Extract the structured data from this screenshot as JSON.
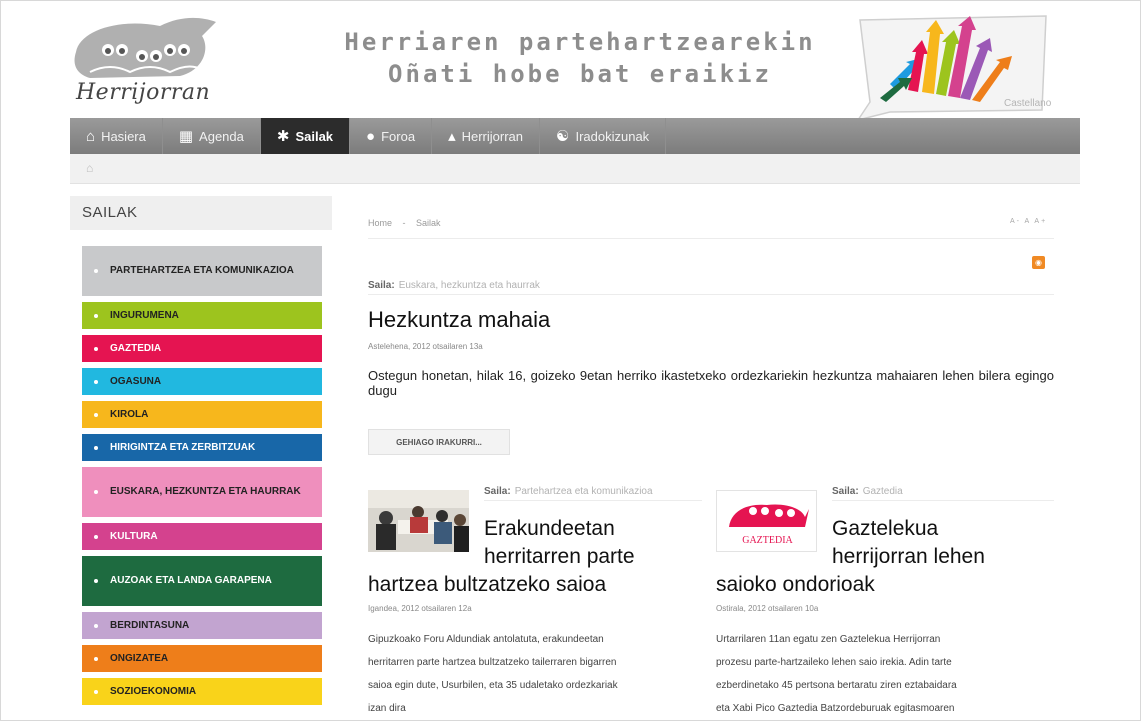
{
  "header": {
    "logo_text": "Herrijorran",
    "slogan_line1": "Herriaren partehartzearekin",
    "slogan_line2": "Oñati hobe bat eraikiz",
    "language_link": "Castellano"
  },
  "nav": {
    "items": [
      {
        "label": "Hasiera",
        "icon": "house-icon"
      },
      {
        "label": "Agenda",
        "icon": "calendar-icon"
      },
      {
        "label": "Sailak",
        "icon": "tools-icon"
      },
      {
        "label": "Foroa",
        "icon": "speech-bubble-icon"
      },
      {
        "label": "Herrijorran",
        "icon": "frog-icon"
      },
      {
        "label": "Iradokizunak",
        "icon": "lightbulb-icon"
      }
    ],
    "active_index": 2,
    "active_color": "#2c2c2c"
  },
  "sidebar": {
    "title": "SAILAK",
    "items": [
      {
        "label": "PARTEHARTZEA ETA KOMUNIKAZIOA",
        "color": "#c8c9cb"
      },
      {
        "label": "INGURUMENA",
        "color": "#9dc41e"
      },
      {
        "label": "GAZTEDIA",
        "color": "#e51451"
      },
      {
        "label": "OGASUNA",
        "color": "#21b8e0"
      },
      {
        "label": "KIROLA",
        "color": "#f7b71c"
      },
      {
        "label": "HIRIGINTZA ETA ZERBITZUAK",
        "color": "#1867a8"
      },
      {
        "label": "EUSKARA, HEZKUNTZA ETA HAURRAK",
        "color": "#ef8fbd"
      },
      {
        "label": "KULTURA",
        "color": "#d4428e"
      },
      {
        "label": "AUZOAK ETA LANDA GARAPENA",
        "color": "#1e6b40"
      },
      {
        "label": "BERDINTASUNA",
        "color": "#c2a4d0"
      },
      {
        "label": "ONGIZATEA",
        "color": "#ee7e1a"
      },
      {
        "label": "SOZIOEKONOMIA",
        "color": "#f9d31a"
      }
    ]
  },
  "main": {
    "breadcrumb": [
      "Home",
      "-",
      "Sailak"
    ],
    "font_tools": "A- A A+",
    "featured": {
      "saila_label": "Saila:",
      "saila_value": "Euskara, hezkuntza eta haurrak",
      "title": "Hezkuntza mahaia",
      "date": "Astelehena, 2012 otsailaren 13a",
      "lead": "Ostegun honetan, hilak 16, goizeko 9etan herriko ikastetxeko ordezkariekin hezkuntza mahaiaren lehen bilera egingo dugu",
      "more_label": "GEHIAGO IRAKURRI..."
    },
    "articles": [
      {
        "saila_label": "Saila:",
        "saila_value": "Partehartzea eta komunikazioa",
        "title_lines": [
          "Erakundeetan",
          "herritarren parte",
          "hartzea bultzatzeko saioa"
        ],
        "date": "Igandea, 2012 otsailaren 12a",
        "body_lines": [
          "Gipuzkoako Foru Aldundiak antolatuta, erakundeetan",
          "herritarren parte hartzea bultzatzeko tailerraren bigarren",
          "saioa egin dute, Usurbilen, eta 35 udaletako ordezkariak",
          "izan dira"
        ]
      },
      {
        "saila_label": "Saila:",
        "saila_value": "Gaztedia",
        "title_lines": [
          "Gaztelekua",
          "herrijorran lehen",
          "saioko ondorioak"
        ],
        "date": "Ostirala, 2012 otsailaren 10a",
        "thumb_text": "GAZTEDIA",
        "body_lines": [
          "Urtarrilaren 11an egatu zen Gaztelekua Herrijorran",
          "prozesu parte-hartzaileko lehen saio irekia. Adin tarte",
          "ezberdinetako 45 pertsona bertaratu ziren eztabaidara",
          "eta Xabi Pico Gaztedia Batzordeburuak egitasmoaren"
        ]
      }
    ]
  }
}
